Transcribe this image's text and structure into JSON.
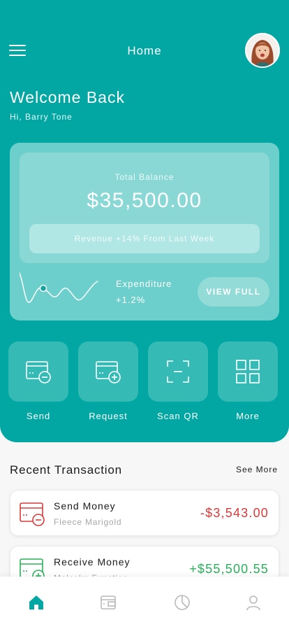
{
  "header": {
    "title": "Home",
    "menu_icon": "hamburger-menu-icon",
    "avatar": "user-avatar"
  },
  "welcome": {
    "title": "Welcome Back",
    "greeting": "Hi, Barry Tone"
  },
  "balance": {
    "label": "Total Balance",
    "amount": "$35,500.00",
    "revenue_note": "Revenue +14% From Last Week",
    "expenditure_label": "Expenditure",
    "expenditure_value": "+1.2%",
    "view_full_label": "VIEW FULL"
  },
  "actions": [
    {
      "label": "Send",
      "icon": "card-minus-icon"
    },
    {
      "label": "Request",
      "icon": "card-plus-icon"
    },
    {
      "label": "Scan QR",
      "icon": "scan-frame-icon"
    },
    {
      "label": "More",
      "icon": "grid-icon"
    }
  ],
  "recent": {
    "title": "Recent Transaction",
    "see_more": "See More",
    "items": [
      {
        "name": "Send Money",
        "person": "Fleece Marigold",
        "amount": "-$3,543.00",
        "icon": "card-minus-icon",
        "color": "#d93a3a"
      },
      {
        "name": "Receive Money",
        "person": "Malcolm Function",
        "amount": "+$55,500.55",
        "icon": "card-plus-icon",
        "color": "#2bb05a"
      }
    ]
  },
  "bottom_nav": [
    {
      "name": "home",
      "icon": "home-icon",
      "active": true
    },
    {
      "name": "wallet",
      "icon": "wallet-icon",
      "active": false
    },
    {
      "name": "stats",
      "icon": "pie-chart-icon",
      "active": false
    },
    {
      "name": "profile",
      "icon": "profile-icon",
      "active": false
    }
  ],
  "colors": {
    "primary": "#02a7a3",
    "negative": "#d93a3a",
    "positive": "#2bb05a"
  }
}
